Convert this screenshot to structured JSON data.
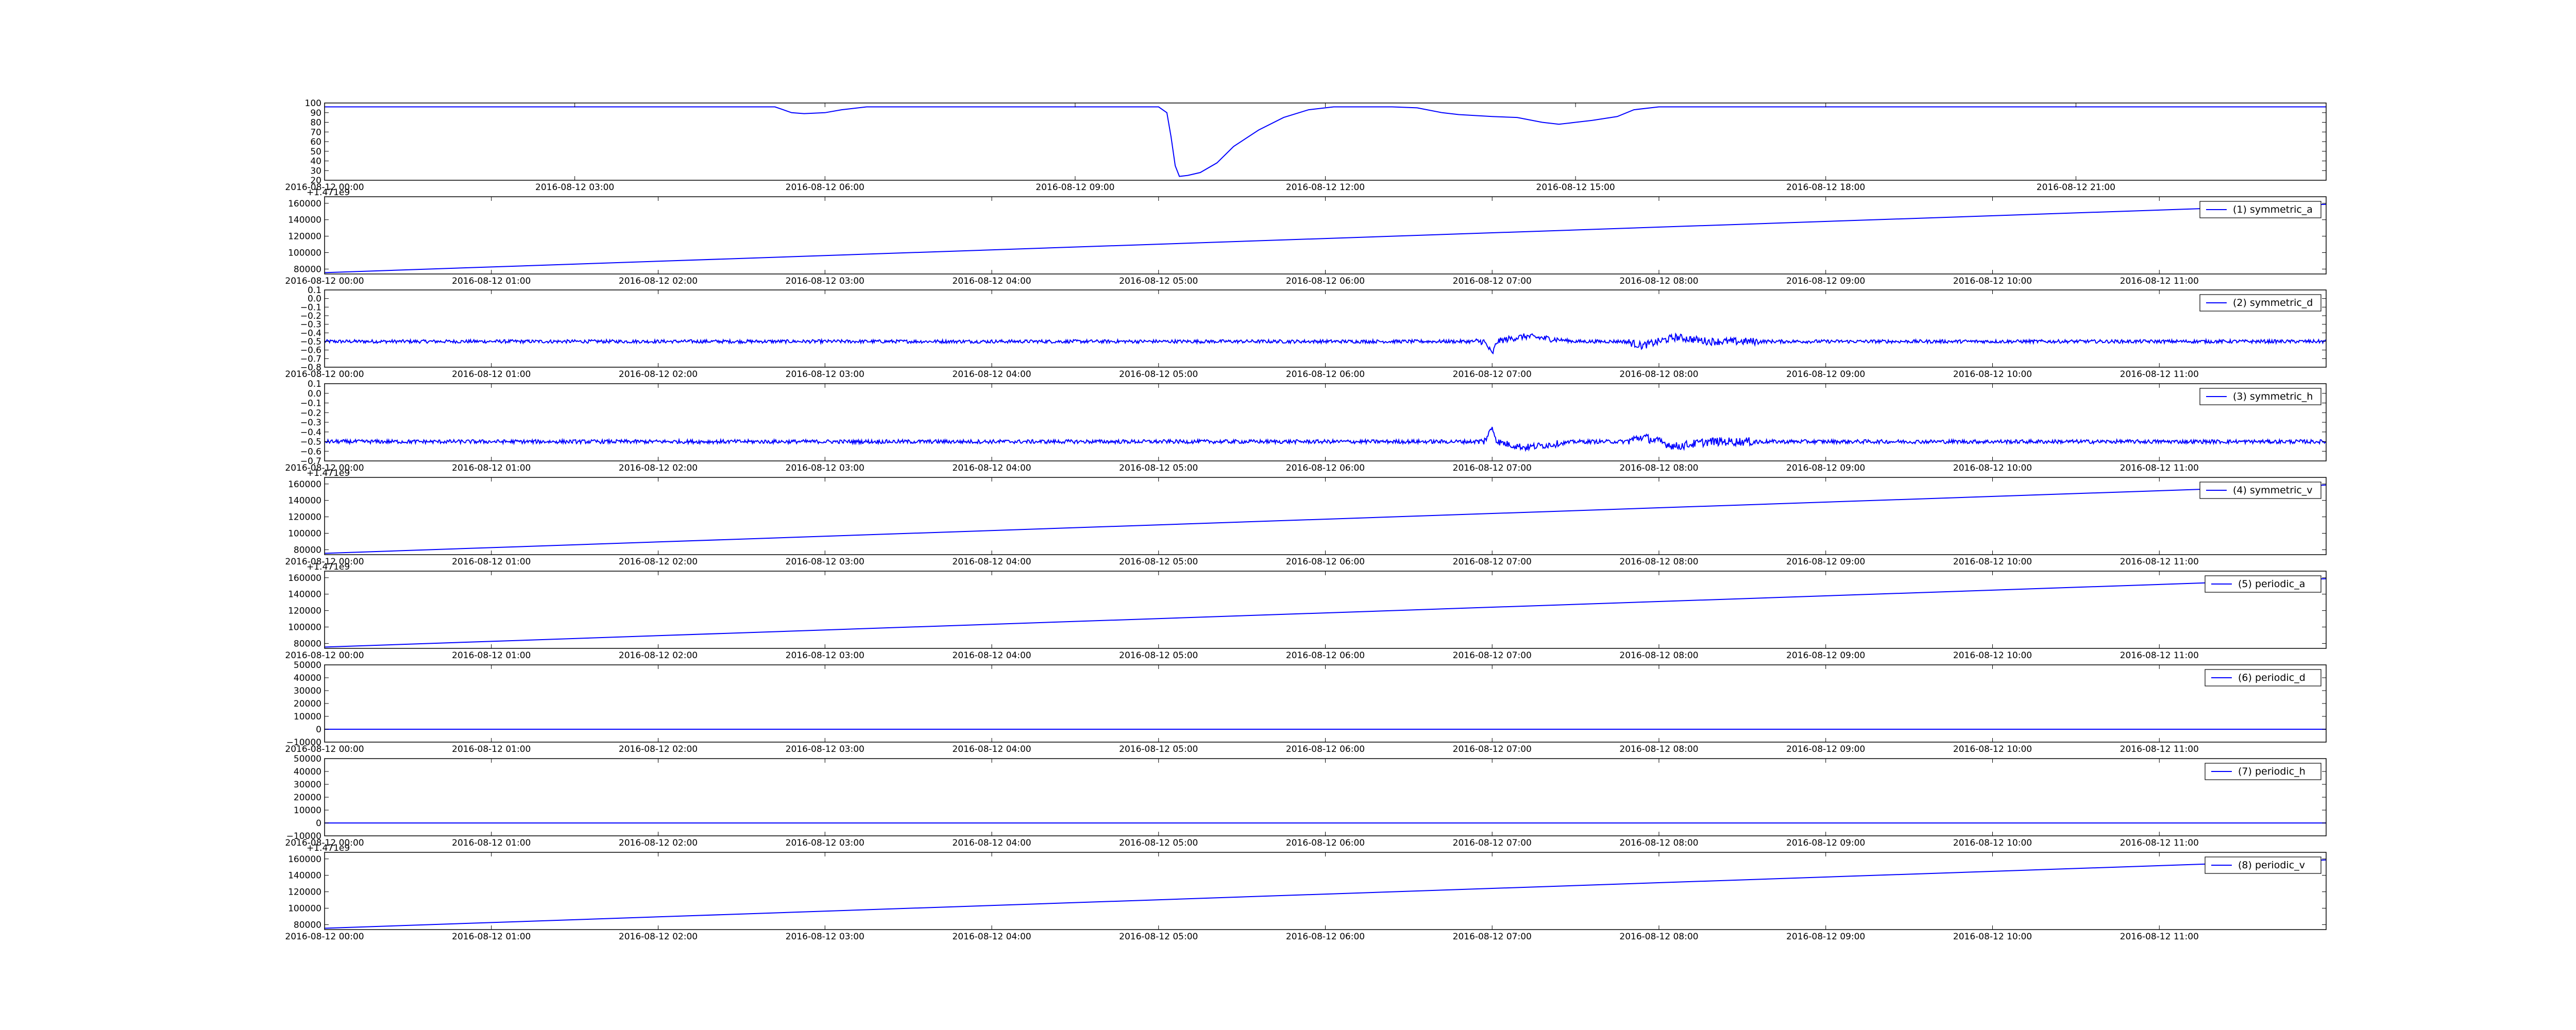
{
  "chart_data": [
    {
      "type": "line",
      "series_name": "",
      "color": "#0000ff",
      "ylim": [
        20,
        100
      ],
      "yticks": [
        20,
        30,
        40,
        50,
        60,
        70,
        80,
        90,
        100
      ],
      "ytick_labels": [
        "20",
        "30",
        "40",
        "50",
        "60",
        "70",
        "80",
        "90",
        "100"
      ],
      "xtick_labels": [
        "2016-08-12 00:00",
        "2016-08-12 03:00",
        "2016-08-12 06:00",
        "2016-08-12 09:00",
        "2016-08-12 12:00",
        "2016-08-12 15:00",
        "2016-08-12 18:00",
        "2016-08-12 21:00"
      ],
      "x_hours": [
        0,
        3,
        6,
        9,
        12,
        15,
        18,
        21
      ],
      "x_range_hours": [
        0,
        24
      ],
      "x": [
        0,
        5.4,
        5.5,
        5.6,
        5.75,
        6.0,
        6.2,
        6.5,
        7.0,
        10.0,
        10.1,
        10.15,
        10.2,
        10.25,
        10.35,
        10.5,
        10.7,
        10.9,
        11.2,
        11.5,
        11.8,
        12.1,
        12.5,
        12.8,
        13.1,
        13.4,
        13.6,
        14.0,
        14.3,
        14.6,
        14.8,
        15.0,
        15.2,
        15.5,
        15.7,
        16.0,
        24.0
      ],
      "y": [
        96,
        96,
        93,
        90,
        89,
        90,
        93,
        96,
        96,
        96,
        90,
        65,
        35,
        24,
        25,
        28,
        38,
        55,
        72,
        85,
        93,
        96,
        96,
        96,
        95,
        90,
        88,
        86,
        85,
        80,
        78,
        80,
        82,
        86,
        93,
        96,
        96
      ],
      "offset_label": "",
      "legend": "",
      "grid": false
    },
    {
      "type": "line",
      "series_name": "symmetric_a",
      "legend": "(1) symmetric_a",
      "legend_position": "top-right",
      "color": "#0000ff",
      "offset_label": "+1.471e9",
      "ylim": [
        74000,
        168000
      ],
      "yticks": [
        80000,
        100000,
        120000,
        140000,
        160000
      ],
      "ytick_labels": [
        "80000",
        "100000",
        "120000",
        "140000",
        "160000"
      ],
      "xtick_labels": [
        "2016-08-12 00:00",
        "2016-08-12 01:00",
        "2016-08-12 02:00",
        "2016-08-12 03:00",
        "2016-08-12 04:00",
        "2016-08-12 05:00",
        "2016-08-12 06:00",
        "2016-08-12 07:00",
        "2016-08-12 08:00",
        "2016-08-12 09:00",
        "2016-08-12 10:00",
        "2016-08-12 11:00"
      ],
      "x_hours": [
        0,
        1,
        2,
        3,
        4,
        5,
        6,
        7,
        8,
        9,
        10,
        11
      ],
      "x_range_hours": [
        0,
        12
      ],
      "x": [
        0,
        12
      ],
      "y": [
        75600,
        158700
      ],
      "grid": false
    },
    {
      "type": "line",
      "series_name": "symmetric_d",
      "legend": "(2) symmetric_d",
      "legend_position": "top-right",
      "color": "#0000ff",
      "offset_label": "",
      "ylim": [
        -0.8,
        0.1
      ],
      "yticks": [
        -0.8,
        -0.7,
        -0.6,
        -0.5,
        -0.4,
        -0.3,
        -0.2,
        -0.1,
        0.0,
        0.1
      ],
      "ytick_labels": [
        "−0.8",
        "−0.7",
        "−0.6",
        "−0.5",
        "−0.4",
        "−0.3",
        "−0.2",
        "−0.1",
        "0.0",
        "0.1"
      ],
      "xtick_labels": [
        "2016-08-12 00:00",
        "2016-08-12 01:00",
        "2016-08-12 02:00",
        "2016-08-12 03:00",
        "2016-08-12 04:00",
        "2016-08-12 05:00",
        "2016-08-12 06:00",
        "2016-08-12 07:00",
        "2016-08-12 08:00",
        "2016-08-12 09:00",
        "2016-08-12 10:00",
        "2016-08-12 11:00"
      ],
      "x_hours": [
        0,
        1,
        2,
        3,
        4,
        5,
        6,
        7,
        8,
        9,
        10,
        11
      ],
      "x_range_hours": [
        0,
        12
      ],
      "baseline": -0.5,
      "noise_amplitude": 0.02,
      "x": [
        0,
        6.95,
        6.98,
        7.0,
        7.03,
        7.1,
        7.2,
        7.3,
        7.5,
        7.8,
        7.9,
        8.1,
        8.3,
        8.6,
        12
      ],
      "y": [
        -0.5,
        -0.5,
        -0.58,
        -0.65,
        -0.5,
        -0.47,
        -0.44,
        -0.46,
        -0.5,
        -0.5,
        -0.55,
        -0.45,
        -0.5,
        -0.5,
        -0.5
      ],
      "grid": false
    },
    {
      "type": "line",
      "series_name": "symmetric_h",
      "legend": "(3) symmetric_h",
      "legend_position": "top-right",
      "color": "#0000ff",
      "offset_label": "",
      "ylim": [
        -0.7,
        0.1
      ],
      "yticks": [
        -0.7,
        -0.6,
        -0.5,
        -0.4,
        -0.3,
        -0.2,
        -0.1,
        0.0,
        0.1
      ],
      "ytick_labels": [
        "−0.7",
        "−0.6",
        "−0.5",
        "−0.4",
        "−0.3",
        "−0.2",
        "−0.1",
        "0.0",
        "0.1"
      ],
      "xtick_labels": [
        "2016-08-12 00:00",
        "2016-08-12 01:00",
        "2016-08-12 02:00",
        "2016-08-12 03:00",
        "2016-08-12 04:00",
        "2016-08-12 05:00",
        "2016-08-12 06:00",
        "2016-08-12 07:00",
        "2016-08-12 08:00",
        "2016-08-12 09:00",
        "2016-08-12 10:00",
        "2016-08-12 11:00"
      ],
      "x_hours": [
        0,
        1,
        2,
        3,
        4,
        5,
        6,
        7,
        8,
        9,
        10,
        11
      ],
      "x_range_hours": [
        0,
        12
      ],
      "baseline": -0.5,
      "noise_amplitude": 0.02,
      "x": [
        0,
        6.95,
        6.98,
        7.0,
        7.03,
        7.1,
        7.2,
        7.3,
        7.5,
        7.8,
        7.9,
        8.1,
        8.3,
        8.6,
        12
      ],
      "y": [
        -0.5,
        -0.5,
        -0.42,
        -0.35,
        -0.5,
        -0.53,
        -0.56,
        -0.54,
        -0.5,
        -0.5,
        -0.45,
        -0.55,
        -0.5,
        -0.5,
        -0.5
      ],
      "grid": false
    },
    {
      "type": "line",
      "series_name": "symmetric_v",
      "legend": "(4) symmetric_v",
      "legend_position": "top-right",
      "color": "#0000ff",
      "offset_label": "+1.471e9",
      "ylim": [
        74000,
        168000
      ],
      "yticks": [
        80000,
        100000,
        120000,
        140000,
        160000
      ],
      "ytick_labels": [
        "80000",
        "100000",
        "120000",
        "140000",
        "160000"
      ],
      "xtick_labels": [
        "2016-08-12 00:00",
        "2016-08-12 01:00",
        "2016-08-12 02:00",
        "2016-08-12 03:00",
        "2016-08-12 04:00",
        "2016-08-12 05:00",
        "2016-08-12 06:00",
        "2016-08-12 07:00",
        "2016-08-12 08:00",
        "2016-08-12 09:00",
        "2016-08-12 10:00",
        "2016-08-12 11:00"
      ],
      "x_hours": [
        0,
        1,
        2,
        3,
        4,
        5,
        6,
        7,
        8,
        9,
        10,
        11
      ],
      "x_range_hours": [
        0,
        12
      ],
      "x": [
        0,
        12
      ],
      "y": [
        75600,
        158700
      ],
      "grid": false
    },
    {
      "type": "line",
      "series_name": "periodic_a",
      "legend": "(5) periodic_a",
      "legend_position": "top-right",
      "color": "#0000ff",
      "offset_label": "+1.471e9",
      "ylim": [
        74000,
        168000
      ],
      "yticks": [
        80000,
        100000,
        120000,
        140000,
        160000
      ],
      "ytick_labels": [
        "80000",
        "100000",
        "120000",
        "140000",
        "160000"
      ],
      "xtick_labels": [
        "2016-08-12 00:00",
        "2016-08-12 01:00",
        "2016-08-12 02:00",
        "2016-08-12 03:00",
        "2016-08-12 04:00",
        "2016-08-12 05:00",
        "2016-08-12 06:00",
        "2016-08-12 07:00",
        "2016-08-12 08:00",
        "2016-08-12 09:00",
        "2016-08-12 10:00",
        "2016-08-12 11:00"
      ],
      "x_hours": [
        0,
        1,
        2,
        3,
        4,
        5,
        6,
        7,
        8,
        9,
        10,
        11
      ],
      "x_range_hours": [
        0,
        12
      ],
      "x": [
        0,
        12
      ],
      "y": [
        75600,
        158700
      ],
      "grid": false
    },
    {
      "type": "line",
      "series_name": "periodic_d",
      "legend": "(6) periodic_d",
      "legend_position": "top-right",
      "color": "#0000ff",
      "offset_label": "",
      "ylim": [
        -10000,
        50000
      ],
      "yticks": [
        -10000,
        0,
        10000,
        20000,
        30000,
        40000,
        50000
      ],
      "ytick_labels": [
        "−10000",
        "0",
        "10000",
        "20000",
        "30000",
        "40000",
        "50000"
      ],
      "xtick_labels": [
        "2016-08-12 00:00",
        "2016-08-12 01:00",
        "2016-08-12 02:00",
        "2016-08-12 03:00",
        "2016-08-12 04:00",
        "2016-08-12 05:00",
        "2016-08-12 06:00",
        "2016-08-12 07:00",
        "2016-08-12 08:00",
        "2016-08-12 09:00",
        "2016-08-12 10:00",
        "2016-08-12 11:00"
      ],
      "x_hours": [
        0,
        1,
        2,
        3,
        4,
        5,
        6,
        7,
        8,
        9,
        10,
        11
      ],
      "x_range_hours": [
        0,
        12
      ],
      "x": [
        0,
        12
      ],
      "y": [
        0,
        0
      ],
      "grid": false
    },
    {
      "type": "line",
      "series_name": "periodic_h",
      "legend": "(7) periodic_h",
      "legend_position": "top-right",
      "color": "#0000ff",
      "offset_label": "",
      "ylim": [
        -10000,
        50000
      ],
      "yticks": [
        -10000,
        0,
        10000,
        20000,
        30000,
        40000,
        50000
      ],
      "ytick_labels": [
        "−10000",
        "0",
        "10000",
        "20000",
        "30000",
        "40000",
        "50000"
      ],
      "xtick_labels": [
        "2016-08-12 00:00",
        "2016-08-12 01:00",
        "2016-08-12 02:00",
        "2016-08-12 03:00",
        "2016-08-12 04:00",
        "2016-08-12 05:00",
        "2016-08-12 06:00",
        "2016-08-12 07:00",
        "2016-08-12 08:00",
        "2016-08-12 09:00",
        "2016-08-12 10:00",
        "2016-08-12 11:00"
      ],
      "x_hours": [
        0,
        1,
        2,
        3,
        4,
        5,
        6,
        7,
        8,
        9,
        10,
        11
      ],
      "x_range_hours": [
        0,
        12
      ],
      "x": [
        0,
        12
      ],
      "y": [
        0,
        0
      ],
      "grid": false
    },
    {
      "type": "line",
      "series_name": "periodic_v",
      "legend": "(8) periodic_v",
      "legend_position": "top-right",
      "color": "#0000ff",
      "offset_label": "+1.471e9",
      "ylim": [
        74000,
        168000
      ],
      "yticks": [
        80000,
        100000,
        120000,
        140000,
        160000
      ],
      "ytick_labels": [
        "80000",
        "100000",
        "120000",
        "140000",
        "160000"
      ],
      "xtick_labels": [
        "2016-08-12 00:00",
        "2016-08-12 01:00",
        "2016-08-12 02:00",
        "2016-08-12 03:00",
        "2016-08-12 04:00",
        "2016-08-12 05:00",
        "2016-08-12 06:00",
        "2016-08-12 07:00",
        "2016-08-12 08:00",
        "2016-08-12 09:00",
        "2016-08-12 10:00",
        "2016-08-12 11:00"
      ],
      "x_hours": [
        0,
        1,
        2,
        3,
        4,
        5,
        6,
        7,
        8,
        9,
        10,
        11
      ],
      "x_range_hours": [
        0,
        12
      ],
      "x": [
        0,
        12
      ],
      "y": [
        75600,
        158700
      ],
      "grid": false
    }
  ]
}
